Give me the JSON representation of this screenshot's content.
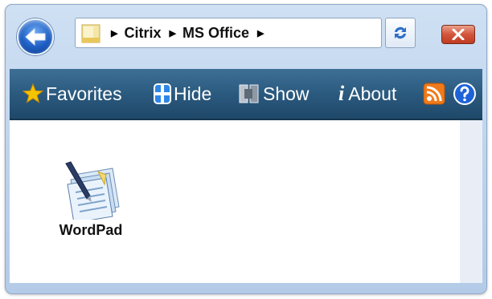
{
  "address_bar": {
    "crumbs": [
      "Citrix",
      "MS Office"
    ]
  },
  "toolbar": {
    "favorites_label": "Favorites",
    "hide_label": "Hide",
    "show_label": "Show",
    "about_label": "About",
    "about_glyph": "i"
  },
  "content": {
    "apps": [
      {
        "label": "WordPad",
        "icon": "wordpad-icon"
      }
    ]
  },
  "colors": {
    "toolbar_bg": "#2b5a7f",
    "window_frame": "#bcd3ec",
    "back_button": "#1f5fc4",
    "close_button": "#d2553b",
    "favorites_star": "#f5c400",
    "rss": "#f07a1a"
  }
}
